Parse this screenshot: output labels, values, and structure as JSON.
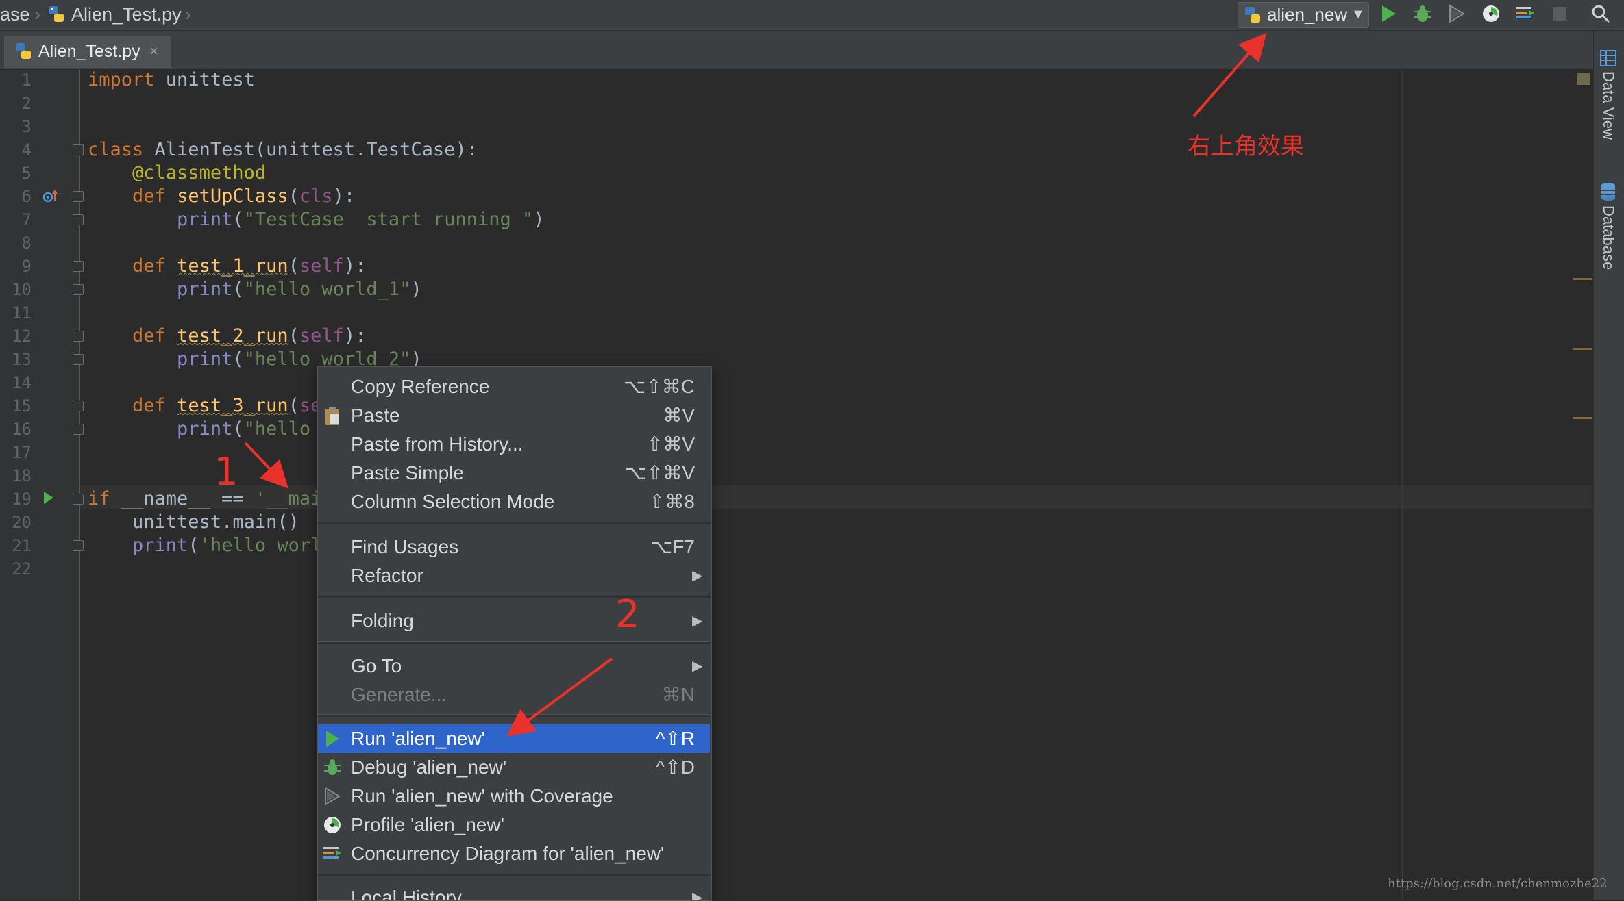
{
  "breadcrumb": {
    "project": "ase",
    "file": "Alien_Test.py"
  },
  "toolbar": {
    "run_config": "alien_new"
  },
  "tab": {
    "label": "Alien_Test.py",
    "close": "×"
  },
  "right_panel": {
    "data_view": "Data View",
    "database": "Database"
  },
  "line_numbers": [
    "1",
    "2",
    "3",
    "4",
    "5",
    "6",
    "7",
    "8",
    "9",
    "10",
    "11",
    "12",
    "13",
    "14",
    "15",
    "16",
    "17",
    "18",
    "19",
    "20",
    "21",
    "22"
  ],
  "code_lines": [
    "import unittest",
    "",
    "",
    "class AlienTest(unittest.TestCase):",
    "    @classmethod",
    "    def setUpClass(cls):",
    "        print(\"TestCase  start running \")",
    "",
    "    def test_1_run(self):",
    "        print(\"hello world_1\")",
    "",
    "    def test_2_run(self):",
    "        print(\"hello world_2\")",
    "",
    "    def test_3_run(se",
    "        print(\"hello ",
    "",
    "",
    "if __name__ == '__mai",
    "    unittest.main()",
    "    print('hello worl",
    ""
  ],
  "context_menu": {
    "items": [
      {
        "label": "Copy Reference",
        "shortcut": "⌥⇧⌘C"
      },
      {
        "label": "Paste",
        "shortcut": "⌘V",
        "icon": "clipboard-icon"
      },
      {
        "label": "Paste from History...",
        "shortcut": "⇧⌘V"
      },
      {
        "label": "Paste Simple",
        "shortcut": "⌥⇧⌘V"
      },
      {
        "label": "Column Selection Mode",
        "shortcut": "⇧⌘8"
      },
      {
        "label": "Find Usages",
        "shortcut": "⌥F7"
      },
      {
        "label": "Refactor",
        "submenu": true
      },
      {
        "label": "Folding",
        "submenu": true
      },
      {
        "label": "Go To",
        "submenu": true
      },
      {
        "label": "Generate...",
        "shortcut": "⌘N",
        "disabled": true
      },
      {
        "label": "Run 'alien_new'",
        "shortcut": "^⇧R",
        "icon": "run-icon",
        "selected": true
      },
      {
        "label": "Debug 'alien_new'",
        "shortcut": "^⇧D",
        "icon": "debug-icon"
      },
      {
        "label": "Run 'alien_new' with Coverage",
        "icon": "coverage-icon"
      },
      {
        "label": "Profile 'alien_new'",
        "icon": "profile-icon"
      },
      {
        "label": "Concurrency Diagram for  'alien_new'",
        "icon": "concurrency-icon"
      },
      {
        "label": "Local History",
        "submenu": true
      }
    ],
    "submenu_arrow": "▶"
  },
  "annotations": {
    "top_right_note": "右上角效果",
    "marker_1": "1",
    "marker_2": "2",
    "color": "#e8322a"
  },
  "watermark": "https://blog.csdn.net/chenmozhe22",
  "colors": {
    "editor_bg": "#2b2b2b",
    "panel_bg": "#3c3f41",
    "keyword": "#cc7832",
    "string": "#6a8759",
    "selection": "#2f65ca"
  }
}
